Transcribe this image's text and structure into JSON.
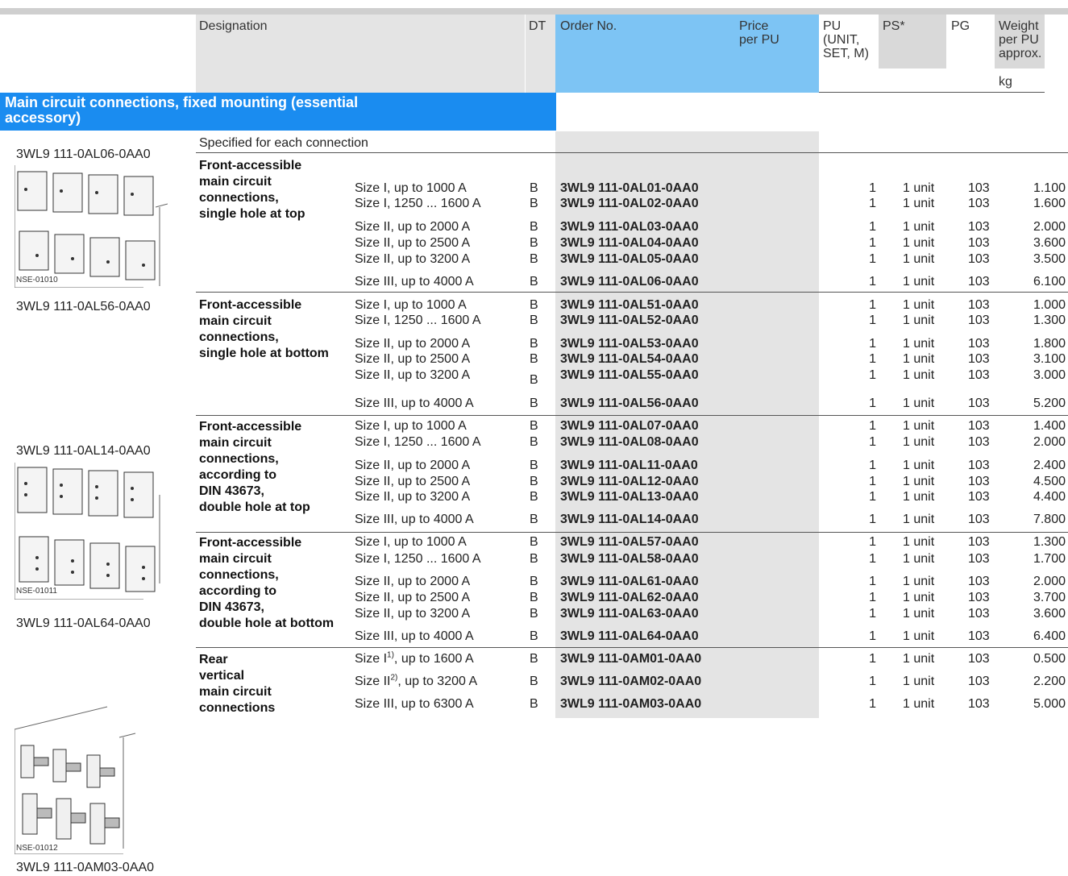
{
  "header": {
    "designation": "Designation",
    "dt": "DT",
    "order_no": "Order No.",
    "price": "Price\nper PU",
    "pu": "PU\n(UNIT,\nSET, M)",
    "ps": "PS*",
    "pg": "PG",
    "weight": "Weight\nper PU\napprox.",
    "kg": "kg"
  },
  "section_title": "Main circuit connections, fixed mounting (essential accessory)",
  "specified": "Specified for each connection",
  "side_labels": {
    "l1": "3WL9 111-0AL06-0AA0",
    "l2": "3WL9 111-0AL56-0AA0",
    "l3": "3WL9 111-0AL14-0AA0",
    "l4": "3WL9 111-0AL64-0AA0",
    "l5": "3WL9 111-0AM03-0AA0",
    "nse1": "NSE-01010",
    "nse2": "NSE-01011",
    "nse3": "NSE-01012"
  },
  "groups": [
    {
      "desc": [
        "Front-accessible",
        "main circuit",
        "connections,",
        "single hole at top"
      ],
      "rows": [
        {
          "size": "Size I, up to 1000 A",
          "dt": "B",
          "order": "3WL9 111-0AL01-0AA0",
          "pu": "1",
          "ps": "1 unit",
          "pg": "103",
          "w": "1.100"
        },
        {
          "size": "Size I, 1250 ... 1600 A",
          "dt": "B",
          "order": "3WL9 111-0AL02-0AA0",
          "pu": "1",
          "ps": "1 unit",
          "pg": "103",
          "w": "1.600"
        },
        {
          "size": "Size II, up to 2000 A",
          "dt": "B",
          "order": "3WL9 111-0AL03-0AA0",
          "pu": "1",
          "ps": "1 unit",
          "pg": "103",
          "w": "2.000"
        },
        {
          "size": "Size II, up to 2500 A",
          "dt": "B",
          "order": "3WL9 111-0AL04-0AA0",
          "pu": "1",
          "ps": "1 unit",
          "pg": "103",
          "w": "3.600"
        },
        {
          "size": "Size II, up to 3200 A",
          "dt": "B",
          "order": "3WL9 111-0AL05-0AA0",
          "pu": "1",
          "ps": "1 unit",
          "pg": "103",
          "w": "3.500"
        },
        {
          "size": "Size III, up to 4000 A",
          "dt": "B",
          "order": "3WL9 111-0AL06-0AA0",
          "pu": "1",
          "ps": "1 unit",
          "pg": "103",
          "w": "6.100"
        }
      ]
    },
    {
      "desc": [
        "Front-accessible",
        "main circuit",
        "connections,",
        "single hole at bottom"
      ],
      "rows": [
        {
          "size": "Size I, up to 1000 A",
          "dt": "B",
          "order": "3WL9 111-0AL51-0AA0",
          "pu": "1",
          "ps": "1 unit",
          "pg": "103",
          "w": "1.000"
        },
        {
          "size": "Size I, 1250 ... 1600 A",
          "dt": "B",
          "order": "3WL9 111-0AL52-0AA0",
          "pu": "1",
          "ps": "1 unit",
          "pg": "103",
          "w": "1.300"
        },
        {
          "size": "Size II, up to 2000 A",
          "dt": "B",
          "order": "3WL9 111-0AL53-0AA0",
          "pu": "1",
          "ps": "1 unit",
          "pg": "103",
          "w": "1.800"
        },
        {
          "size": "Size II, up to 2500 A",
          "dt": "B",
          "order": "3WL9 111-0AL54-0AA0",
          "pu": "1",
          "ps": "1 unit",
          "pg": "103",
          "w": "3.100"
        },
        {
          "size": "Size II, up to 3200 A",
          "dt": "B",
          "order": "3WL9 111-0AL55-0AA0",
          "pu": "1",
          "ps": "1 unit",
          "pg": "103",
          "w": "3.000"
        },
        {
          "size": "Size III, up to 4000 A",
          "dt": "B",
          "order": "3WL9 111-0AL56-0AA0",
          "pu": "1",
          "ps": "1 unit",
          "pg": "103",
          "w": "5.200"
        }
      ]
    },
    {
      "desc": [
        "Front-accessible",
        "main circuit",
        "connections,",
        "according to",
        "DIN 43673,",
        "double hole at top"
      ],
      "rows": [
        {
          "size": "Size I, up to 1000 A",
          "dt": "B",
          "order": "3WL9 111-0AL07-0AA0",
          "pu": "1",
          "ps": "1 unit",
          "pg": "103",
          "w": "1.400"
        },
        {
          "size": "Size I, 1250 ... 1600 A",
          "dt": "B",
          "order": "3WL9 111-0AL08-0AA0",
          "pu": "1",
          "ps": "1 unit",
          "pg": "103",
          "w": "2.000"
        },
        {
          "size": "Size II, up to 2000 A",
          "dt": "B",
          "order": "3WL9 111-0AL11-0AA0",
          "pu": "1",
          "ps": "1 unit",
          "pg": "103",
          "w": "2.400"
        },
        {
          "size": "Size II, up to 2500 A",
          "dt": "B",
          "order": "3WL9 111-0AL12-0AA0",
          "pu": "1",
          "ps": "1 unit",
          "pg": "103",
          "w": "4.500"
        },
        {
          "size": "Size II, up to 3200 A",
          "dt": "B",
          "order": "3WL9 111-0AL13-0AA0",
          "pu": "1",
          "ps": "1 unit",
          "pg": "103",
          "w": "4.400"
        },
        {
          "size": "Size III, up to 4000 A",
          "dt": "B",
          "order": "3WL9 111-0AL14-0AA0",
          "pu": "1",
          "ps": "1 unit",
          "pg": "103",
          "w": "7.800"
        }
      ]
    },
    {
      "desc": [
        "Front-accessible",
        "main circuit",
        "connections,",
        "according to",
        "DIN 43673,",
        "double hole at bottom"
      ],
      "rows": [
        {
          "size": "Size I, up to 1000 A",
          "dt": "B",
          "order": "3WL9 111-0AL57-0AA0",
          "pu": "1",
          "ps": "1 unit",
          "pg": "103",
          "w": "1.300"
        },
        {
          "size": "Size I, 1250 ... 1600 A",
          "dt": "B",
          "order": "3WL9 111-0AL58-0AA0",
          "pu": "1",
          "ps": "1 unit",
          "pg": "103",
          "w": "1.700"
        },
        {
          "size": "Size II, up to 2000 A",
          "dt": "B",
          "order": "3WL9 111-0AL61-0AA0",
          "pu": "1",
          "ps": "1 unit",
          "pg": "103",
          "w": "2.000"
        },
        {
          "size": "Size II, up to 2500 A",
          "dt": "B",
          "order": "3WL9 111-0AL62-0AA0",
          "pu": "1",
          "ps": "1 unit",
          "pg": "103",
          "w": "3.700"
        },
        {
          "size": "Size II, up to 3200 A",
          "dt": "B",
          "order": "3WL9 111-0AL63-0AA0",
          "pu": "1",
          "ps": "1 unit",
          "pg": "103",
          "w": "3.600"
        },
        {
          "size": "Size III, up to 4000 A",
          "dt": "B",
          "order": "3WL9 111-0AL64-0AA0",
          "pu": "1",
          "ps": "1 unit",
          "pg": "103",
          "w": "6.400"
        }
      ]
    },
    {
      "desc": [
        "Rear",
        "vertical",
        "main circuit",
        "connections"
      ],
      "rows": [
        {
          "size_pre": "Size I",
          "size_sup": "1)",
          "size_post": ", up to 1600 A",
          "dt": "B",
          "order": "3WL9 111-0AM01-0AA0",
          "pu": "1",
          "ps": "1 unit",
          "pg": "103",
          "w": "0.500"
        },
        {
          "size_pre": "Size II",
          "size_sup": "2)",
          "size_post": ", up to 3200 A",
          "dt": "B",
          "order": "3WL9 111-0AM02-0AA0",
          "pu": "1",
          "ps": "1 unit",
          "pg": "103",
          "w": "2.200"
        },
        {
          "size": "Size III, up to 6300 A",
          "dt": "B",
          "order": "3WL9 111-0AM03-0AA0",
          "pu": "1",
          "ps": "1 unit",
          "pg": "103",
          "w": "5.000"
        }
      ]
    }
  ]
}
